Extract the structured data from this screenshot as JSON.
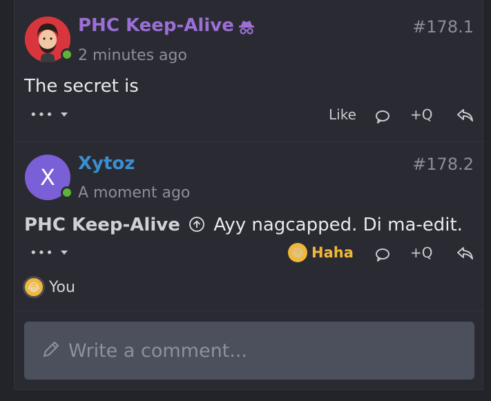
{
  "posts": [
    {
      "username": "PHC Keep-Alive",
      "time": "2 minutes ago",
      "number": "#178.1",
      "content": "The secret is",
      "more_label": "•••",
      "like_label": "Like",
      "quote_label": "+Q"
    },
    {
      "username": "Xytoz",
      "avatar_letter": "X",
      "time": "A moment ago",
      "number": "#178.2",
      "quoted_user": "PHC Keep-Alive",
      "content": "Ayy nagcapped. Di ma-edit.",
      "more_label": "•••",
      "reaction_label": "Haha",
      "quote_label": "+Q",
      "reactors_label": "You"
    }
  ],
  "comment": {
    "placeholder": "Write a comment..."
  },
  "colors": {
    "background": "#232429",
    "panel": "#2a2b32",
    "username_purple": "#9b6fd6",
    "username_blue": "#3b8fd0",
    "online": "#5fb239",
    "haha": "#f0b73a"
  },
  "icons": [
    "incognito-icon",
    "caret-down-icon",
    "comment-icon",
    "reply-icon",
    "quote-arrow-icon",
    "laughing-emoji-icon",
    "pencil-icon"
  ]
}
